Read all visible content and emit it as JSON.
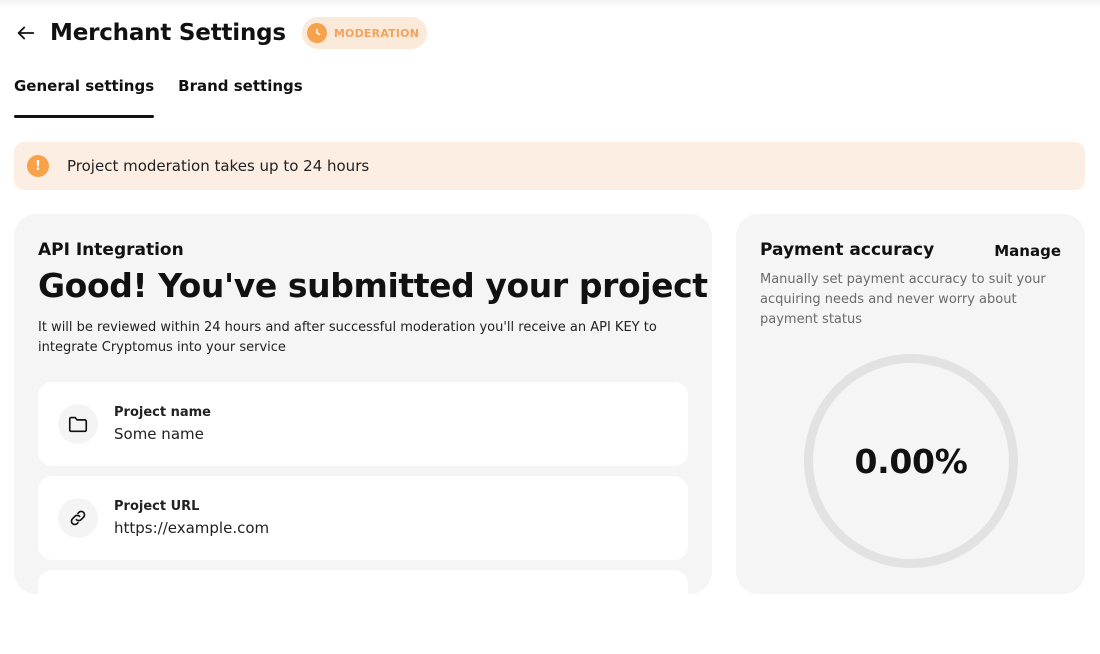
{
  "header": {
    "title": "Merchant Settings",
    "status_badge": "MODERATION"
  },
  "tabs": [
    {
      "label": "General settings",
      "active": true
    },
    {
      "label": "Brand settings",
      "active": false
    }
  ],
  "alert": {
    "icon": "!",
    "text": "Project moderation takes up to 24 hours"
  },
  "api_integration": {
    "section_label": "API Integration",
    "title": "Good! You've submitted your project",
    "description": "It will be reviewed within 24 hours and after successful moderation you'll receive an API KEY to integrate Cryptomus into your service",
    "fields": [
      {
        "label": "Project name",
        "value": "Some name",
        "icon": "folder-icon"
      },
      {
        "label": "Project URL",
        "value": "https://example.com",
        "icon": "link-icon"
      }
    ]
  },
  "payment_accuracy": {
    "title": "Payment accuracy",
    "manage_label": "Manage",
    "description": "Manually set payment accuracy to suit your acquiring needs and never worry about payment status",
    "value": "0.00%"
  },
  "colors": {
    "accent": "#f7a24b",
    "badge_bg": "#fbe9da",
    "alert_bg": "#fdeee3",
    "card_bg": "#f5f5f5"
  }
}
